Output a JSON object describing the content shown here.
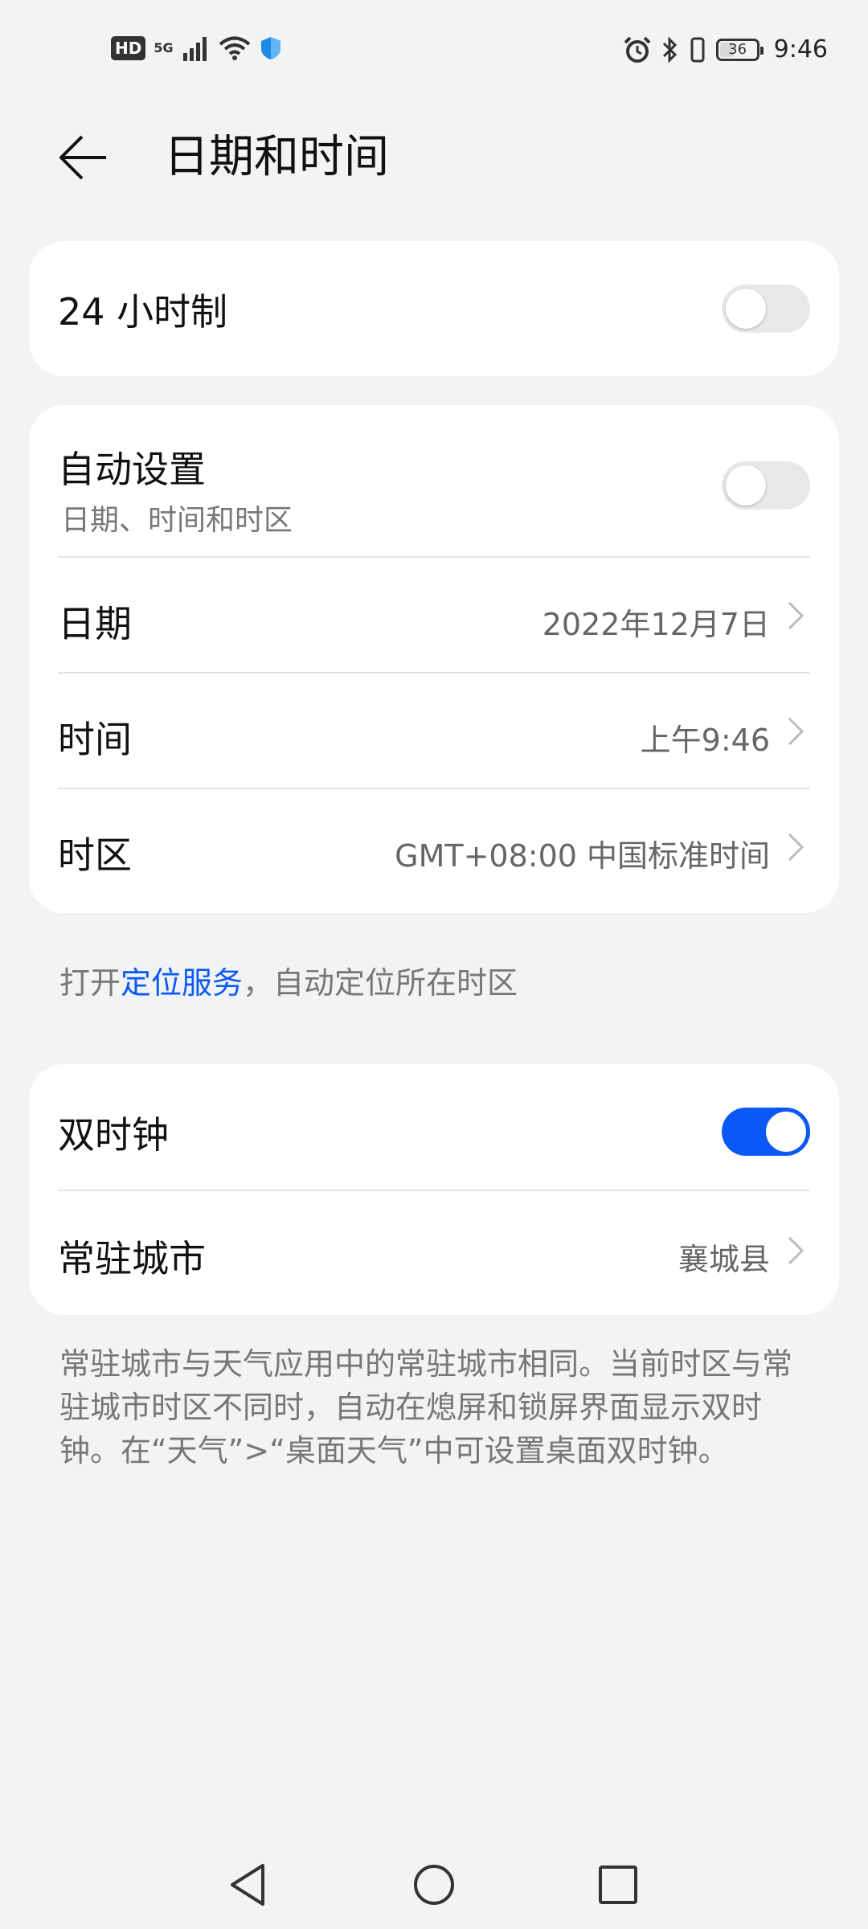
{
  "status_bar": {
    "hd": "HD",
    "network": "5G",
    "battery": "36",
    "time": "9:46"
  },
  "header": {
    "title": "日期和时间"
  },
  "settings": {
    "hour24_label": "24 小时制",
    "hour24_on": false,
    "auto_label": "自动设置",
    "auto_sub": "日期、时间和时区",
    "auto_on": false,
    "date_label": "日期",
    "date_value": "2022年12月7日",
    "time_label": "时间",
    "time_value": "上午9:46",
    "tz_label": "时区",
    "tz_value": "GMT+08:00 中国标准时间"
  },
  "location_note": {
    "prefix": "打开",
    "link": "定位服务",
    "suffix": "，自动定位所在时区"
  },
  "dual_clock": {
    "label": "双时钟",
    "on": true,
    "city_label": "常驻城市",
    "city_value": "襄城县"
  },
  "footer_note": "常驻城市与天气应用中的常驻城市相同。当前时区与常驻城市时区不同时，自动在熄屏和锁屏界面显示双时钟。在“天气”>“桌面天气”中可设置桌面双时钟。",
  "colors": {
    "accent": "#0a59f7",
    "background": "#f1f3f5",
    "card": "#ffffff"
  }
}
